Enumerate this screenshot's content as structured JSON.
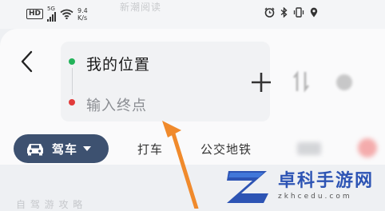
{
  "status_bar": {
    "badge_hd": "HD",
    "signal_type": "5G",
    "network_speed_value": "9.4",
    "network_speed_unit": "K/s",
    "faded_text": "新潮阅读"
  },
  "route": {
    "origin": "我的位置",
    "destination_placeholder": "输入终点"
  },
  "tabs": {
    "drive": "驾车",
    "taxi": "打车",
    "transit": "公交地铁"
  },
  "bottom_faded_text": "自 驾 游 攻 略",
  "watermark": {
    "title": "卓科手游网",
    "subtitle": "zkhcedu.com"
  },
  "colors": {
    "accent_tab_bg": "#3d5170",
    "origin_dot": "#23b35a",
    "destination_dot": "#e23b3b",
    "annotation_arrow": "#f08a2c",
    "watermark_blue": "#2d54b4"
  },
  "icons": [
    "back-arrow-icon",
    "plus-icon",
    "swap-icon",
    "more-icon",
    "car-icon",
    "chevron-down-icon",
    "alarm-icon",
    "bluetooth-icon",
    "vibrate-icon",
    "location-icon",
    "wifi-icon",
    "signal-icon"
  ]
}
